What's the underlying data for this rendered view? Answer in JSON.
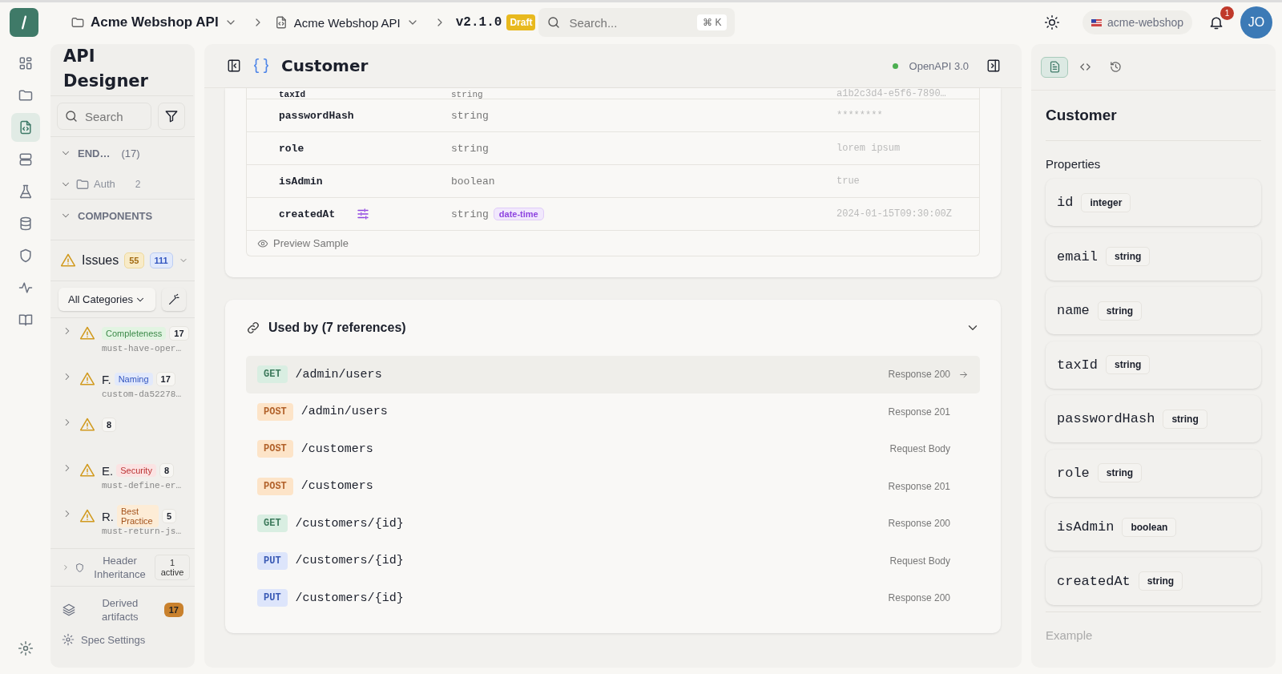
{
  "topbar": {
    "breadcrumbs": [
      {
        "kind": "folder",
        "label": "Acme Webshop API"
      },
      {
        "kind": "file",
        "label": "Acme Webshop API"
      }
    ],
    "version": "v2.1.0",
    "version_badge": "Draft",
    "search": {
      "placeholder": "Search...",
      "shortcut": "⌘ K"
    },
    "workspace": "acme-webshop",
    "notifications": "1",
    "avatar": "JO"
  },
  "rail": [
    {
      "kind": "grid",
      "selected": false
    },
    {
      "kind": "folder",
      "selected": false
    },
    {
      "kind": "code-file",
      "selected": true
    },
    {
      "kind": "server",
      "selected": false
    },
    {
      "kind": "flask",
      "selected": false
    },
    {
      "kind": "database",
      "selected": false
    },
    {
      "kind": "shield",
      "selected": false
    },
    {
      "kind": "pulse",
      "selected": false
    },
    {
      "kind": "book",
      "selected": false
    }
  ],
  "sidebar": {
    "title": "API Designer",
    "search": {
      "placeholder": "Search"
    },
    "sections": [
      {
        "label": "END…",
        "count": "(17)",
        "expanded": true,
        "children": [
          {
            "label": "Auth",
            "count": "2",
            "expanded": true
          }
        ]
      },
      {
        "label": "COMPONENTS",
        "expanded": true
      }
    ],
    "issues": {
      "label": "Issues",
      "warnings": "55",
      "infos": "111",
      "filter": "All Categories",
      "items": [
        {
          "category": "Completeness",
          "kind": "completeness",
          "count": "17",
          "rule": "must-have-oper…"
        },
        {
          "title": "F.",
          "category": "Naming",
          "kind": "naming",
          "count": "17",
          "rule": "custom-da52278…"
        },
        {
          "kind": "none",
          "count": "8"
        },
        {
          "title": "E.",
          "category": "Security",
          "kind": "security",
          "count": "8",
          "rule": "must-define-er…"
        },
        {
          "title": "R.",
          "category": "Best Practice",
          "kind": "practice",
          "count": "5",
          "rule": "must-return-js…"
        }
      ]
    },
    "header_inheritance": {
      "label": "Header Inheritance",
      "status": "1 active"
    },
    "derived": {
      "label": "Derived artifacts",
      "count": "17"
    },
    "settings": "Spec Settings"
  },
  "main": {
    "title": "Customer",
    "spec": "OpenAPI 3.0",
    "properties": [
      {
        "name": "taxId",
        "type": "string",
        "example": "a1b2c3d4-e5f6-7890…"
      },
      {
        "name": "passwordHash",
        "type": "string",
        "example": "********"
      },
      {
        "name": "role",
        "type": "string",
        "example": "lorem ipsum"
      },
      {
        "name": "isAdmin",
        "type": "boolean",
        "example": "true"
      },
      {
        "name": "createdAt",
        "type": "string",
        "format": "date-time",
        "constraints": true,
        "example": "2024-01-15T09:30:00Z"
      }
    ],
    "preview": "Preview Sample",
    "used_by": {
      "title": "Used by (7 references)",
      "expanded": true,
      "refs": [
        {
          "method": "GET",
          "path": "/admin/users",
          "usage": "Response 200",
          "selected": true
        },
        {
          "method": "POST",
          "path": "/admin/users",
          "usage": "Response 201",
          "selected": false
        },
        {
          "method": "POST",
          "path": "/customers",
          "usage": "Request Body",
          "selected": false
        },
        {
          "method": "POST",
          "path": "/customers",
          "usage": "Response 201",
          "selected": false
        },
        {
          "method": "GET",
          "path": "/customers/{id}",
          "usage": "Response 200",
          "selected": false
        },
        {
          "method": "PUT",
          "path": "/customers/{id}",
          "usage": "Request Body",
          "selected": false
        },
        {
          "method": "PUT",
          "path": "/customers/{id}",
          "usage": "Response 200",
          "selected": false
        }
      ]
    }
  },
  "inspector": {
    "tabs": [
      {
        "kind": "doc",
        "selected": true
      },
      {
        "kind": "code",
        "selected": false
      },
      {
        "kind": "history",
        "selected": false
      }
    ],
    "title": "Customer",
    "properties_label": "Properties",
    "properties": [
      {
        "name": "id",
        "type": "integer"
      },
      {
        "name": "email",
        "type": "string"
      },
      {
        "name": "name",
        "type": "string"
      },
      {
        "name": "taxId",
        "type": "string"
      },
      {
        "name": "passwordHash",
        "type": "string"
      },
      {
        "name": "role",
        "type": "string"
      },
      {
        "name": "isAdmin",
        "type": "boolean"
      },
      {
        "name": "createdAt",
        "type": "string"
      }
    ],
    "example_label": "Example"
  }
}
